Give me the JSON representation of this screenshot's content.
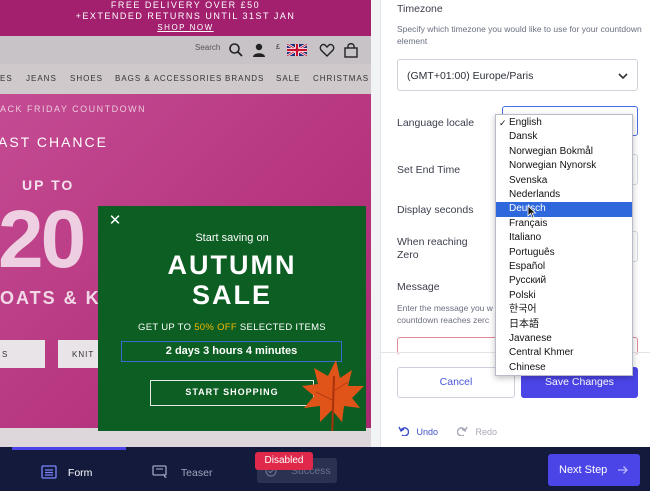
{
  "promo": {
    "line1": "FREE DELIVERY OVER £50",
    "line2": "+EXTENDED RETURNS UNTIL 31ST JAN",
    "line3": "SHOP NOW"
  },
  "header": {
    "search_label": "Search",
    "currency": "£"
  },
  "nav": [
    "ES",
    "JEANS",
    "SHOES",
    "BAGS & ACCESSORIES",
    "BRANDS",
    "SALE",
    "CHRISTMAS"
  ],
  "hero": {
    "countdown_label": "ACK FRIDAY COUNTDOWN",
    "last_chance": "AST CHANCE",
    "up_to": "UP TO",
    "big_number": "20",
    "coats": "OATS & K",
    "pill1": "S",
    "pill2": "KNIT"
  },
  "popup": {
    "subtitle": "Start saving on",
    "title_line1": "AUTUMN",
    "title_line2": "SALE",
    "offer_prefix": "GET UP TO",
    "offer_pct": "50% OFF",
    "offer_suffix": "SELECTED ITEMS",
    "countdown": "2 days 3 hours 4 minutes",
    "cta": "START SHOPPING",
    "accent_color": "#f6b800"
  },
  "settings": {
    "timezone_label": "Timezone",
    "timezone_help": "Specify which timezone you would like to use for your countdown element",
    "timezone_value": "(GMT+01:00) Europe/Paris",
    "locale_label": "Language locale",
    "end_time_label": "Set End Time",
    "display_seconds_label": "Display seconds",
    "reaching_zero_label": "When reaching Zero",
    "message_label": "Message",
    "message_help": "Enter the message you w countdown reaches zerc",
    "cancel_label": "Cancel",
    "save_label": "Save Changes",
    "undo_label": "Undo",
    "redo_label": "Redo"
  },
  "locale_options": [
    "English",
    "Dansk",
    "Norwegian Bokmål",
    "Norwegian Nynorsk",
    "Svenska",
    "Nederlands",
    "Deutsch",
    "Français",
    "Italiano",
    "Português",
    "Español",
    "Русский",
    "Polski",
    "한국어",
    "日本語",
    "Javanese",
    "Central Khmer",
    "Chinese"
  ],
  "locale_selected": "English",
  "locale_highlighted": "Deutsch",
  "bottombar": {
    "form_label": "Form",
    "teaser_label": "Teaser",
    "success_label": "Success",
    "disabled_badge": "Disabled",
    "next_label": "Next Step"
  },
  "colors": {
    "brand": "#4b45e8",
    "popup_bg": "#0d5e23",
    "badge": "#e0294a",
    "bar": "#141a3c"
  }
}
